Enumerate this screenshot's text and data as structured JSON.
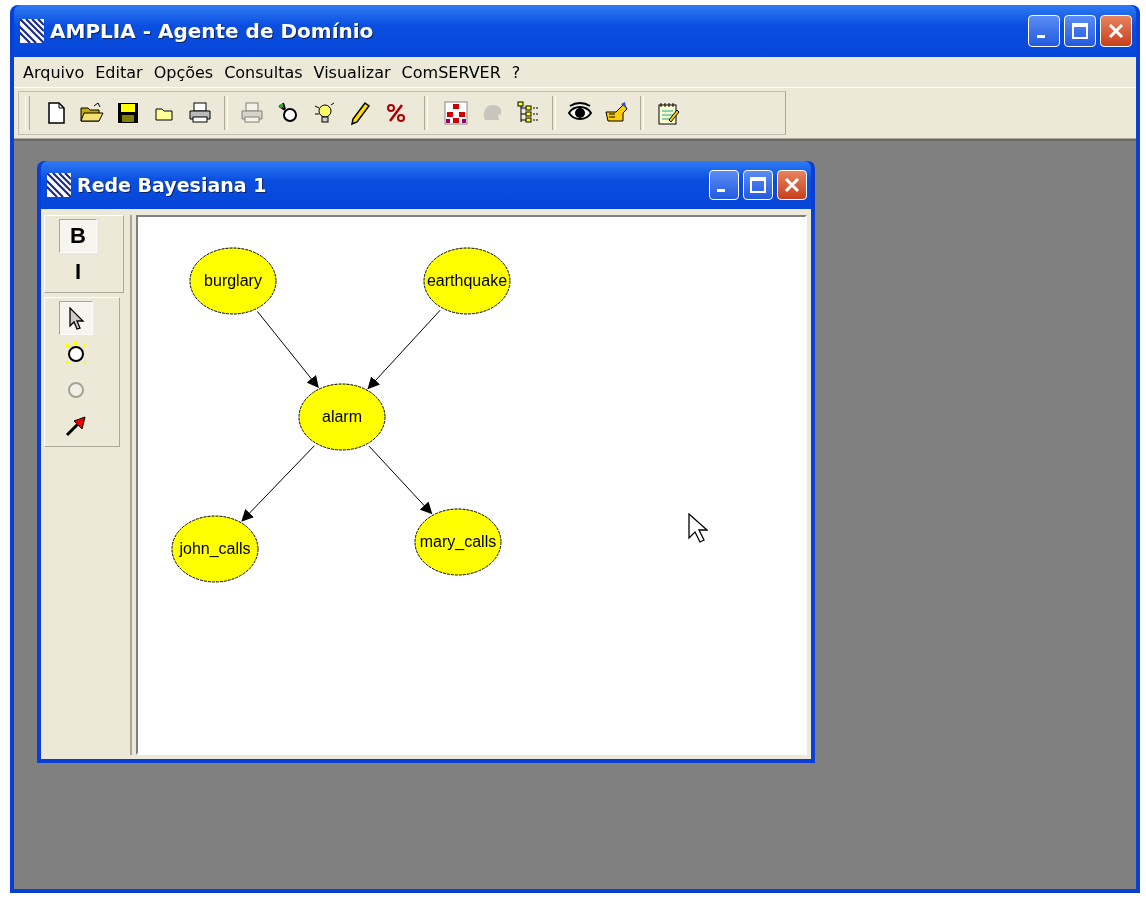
{
  "window": {
    "title": "AMPLIA - Agente de Domínio"
  },
  "menu": [
    "Arquivo",
    "Editar",
    "Opções",
    "Consultas",
    "Visualizar",
    "ComSERVER",
    "?"
  ],
  "toolbar": [
    [
      {
        "kind": "new",
        "disabled": false
      },
      {
        "kind": "open",
        "disabled": false
      },
      {
        "kind": "save",
        "disabled": false
      },
      {
        "kind": "folder",
        "disabled": false
      },
      {
        "kind": "print",
        "disabled": false
      }
    ],
    [
      {
        "kind": "print",
        "disabled": true
      },
      {
        "kind": "wand",
        "disabled": false
      },
      {
        "kind": "bulb",
        "disabled": false
      },
      {
        "kind": "pencil",
        "disabled": false
      },
      {
        "kind": "percent",
        "disabled": false
      }
    ],
    [
      {
        "kind": "network",
        "disabled": false
      },
      {
        "kind": "head",
        "disabled": true
      },
      {
        "kind": "tree",
        "disabled": false
      }
    ],
    [
      {
        "kind": "eye",
        "disabled": false
      },
      {
        "kind": "hand",
        "disabled": false
      }
    ],
    [
      {
        "kind": "notepad",
        "disabled": false
      }
    ]
  ],
  "child_window": {
    "title": "Rede Bayesiana 1",
    "format_tools": [
      {
        "label": "B",
        "selected": true
      },
      {
        "label": "I",
        "selected": false
      }
    ],
    "edit_tools": [
      {
        "kind": "pointer",
        "selected": true,
        "disabled": false
      },
      {
        "kind": "node",
        "selected": false,
        "disabled": false
      },
      {
        "kind": "node",
        "selected": false,
        "disabled": true
      },
      {
        "kind": "arrow",
        "selected": false,
        "disabled": false
      }
    ],
    "nodes": [
      {
        "label": "burglary"
      },
      {
        "label": "earthquake"
      },
      {
        "label": "alarm"
      },
      {
        "label": "john_calls"
      },
      {
        "label": "mary_calls"
      }
    ]
  }
}
